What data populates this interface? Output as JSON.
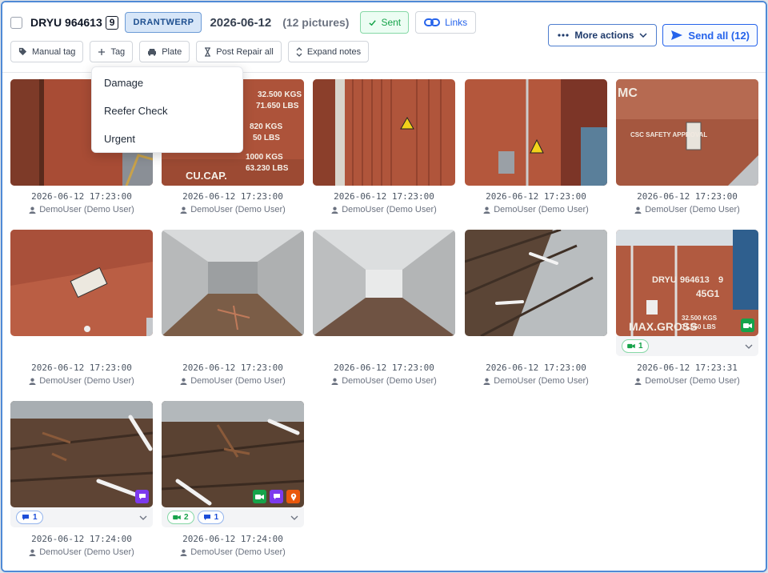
{
  "header": {
    "container_id": "DRYU 964613",
    "check_digit": "9",
    "location": "DRANTWERP",
    "date": "2026-06-12",
    "picture_count": "(12 pictures)",
    "sent_label": "Sent",
    "links_label": "Links",
    "more_actions_label": "More actions",
    "send_all_label": "Send all (12)"
  },
  "toolbar": {
    "manual_tag": "Manual tag",
    "tag": "Tag",
    "plate": "Plate",
    "post_repair_all": "Post Repair all",
    "expand_notes": "Expand notes"
  },
  "tag_menu": {
    "items": [
      "Damage",
      "Reefer Check",
      "Urgent"
    ]
  },
  "photos": [
    {
      "timestamp": "2026-06-12 17:23:00",
      "user": "DemoUser (Demo User)"
    },
    {
      "timestamp": "2026-06-12 17:23:00",
      "user": "DemoUser (Demo User)",
      "overlay_text": [
        "32.500 KGS",
        "71.650 LBS",
        "820 KGS",
        "50 LBS",
        "CU.CAP.",
        "1000 KGS",
        "63.230 LBS"
      ]
    },
    {
      "timestamp": "2026-06-12 17:23:00",
      "user": "DemoUser (Demo User)"
    },
    {
      "timestamp": "2026-06-12 17:23:00",
      "user": "DemoUser (Demo User)"
    },
    {
      "timestamp": "2026-06-12 17:23:00",
      "user": "DemoUser (Demo User)",
      "overlay_text": [
        "MC",
        "CSC SAFETY APPROVAL"
      ]
    },
    {
      "timestamp": "2026-06-12 17:23:00",
      "user": "DemoUser (Demo User)"
    },
    {
      "timestamp": "2026-06-12 17:23:00",
      "user": "DemoUser (Demo User)"
    },
    {
      "timestamp": "2026-06-12 17:23:00",
      "user": "DemoUser (Demo User)"
    },
    {
      "timestamp": "2026-06-12 17:23:00",
      "user": "DemoUser (Demo User)"
    },
    {
      "timestamp": "2026-06-12 17:23:31",
      "user": "DemoUser (Demo User)",
      "chips": {
        "green": "1"
      },
      "overlay_text": [
        "DRYU",
        "964613",
        "9",
        "45G1",
        "MAX.GROSS",
        "32.500 KGS",
        "71.650 LBS"
      ]
    },
    {
      "timestamp": "2026-06-12 17:24:00",
      "user": "DemoUser (Demo User)",
      "chips": {
        "blue": "1"
      }
    },
    {
      "timestamp": "2026-06-12 17:24:00",
      "user": "DemoUser (Demo User)",
      "chips": {
        "green": "2",
        "blue": "1"
      }
    }
  ],
  "colors": {
    "accent": "#2563eb",
    "sent": "#16a34a",
    "container": "#b5533c",
    "frame": "#4f8ad6"
  }
}
